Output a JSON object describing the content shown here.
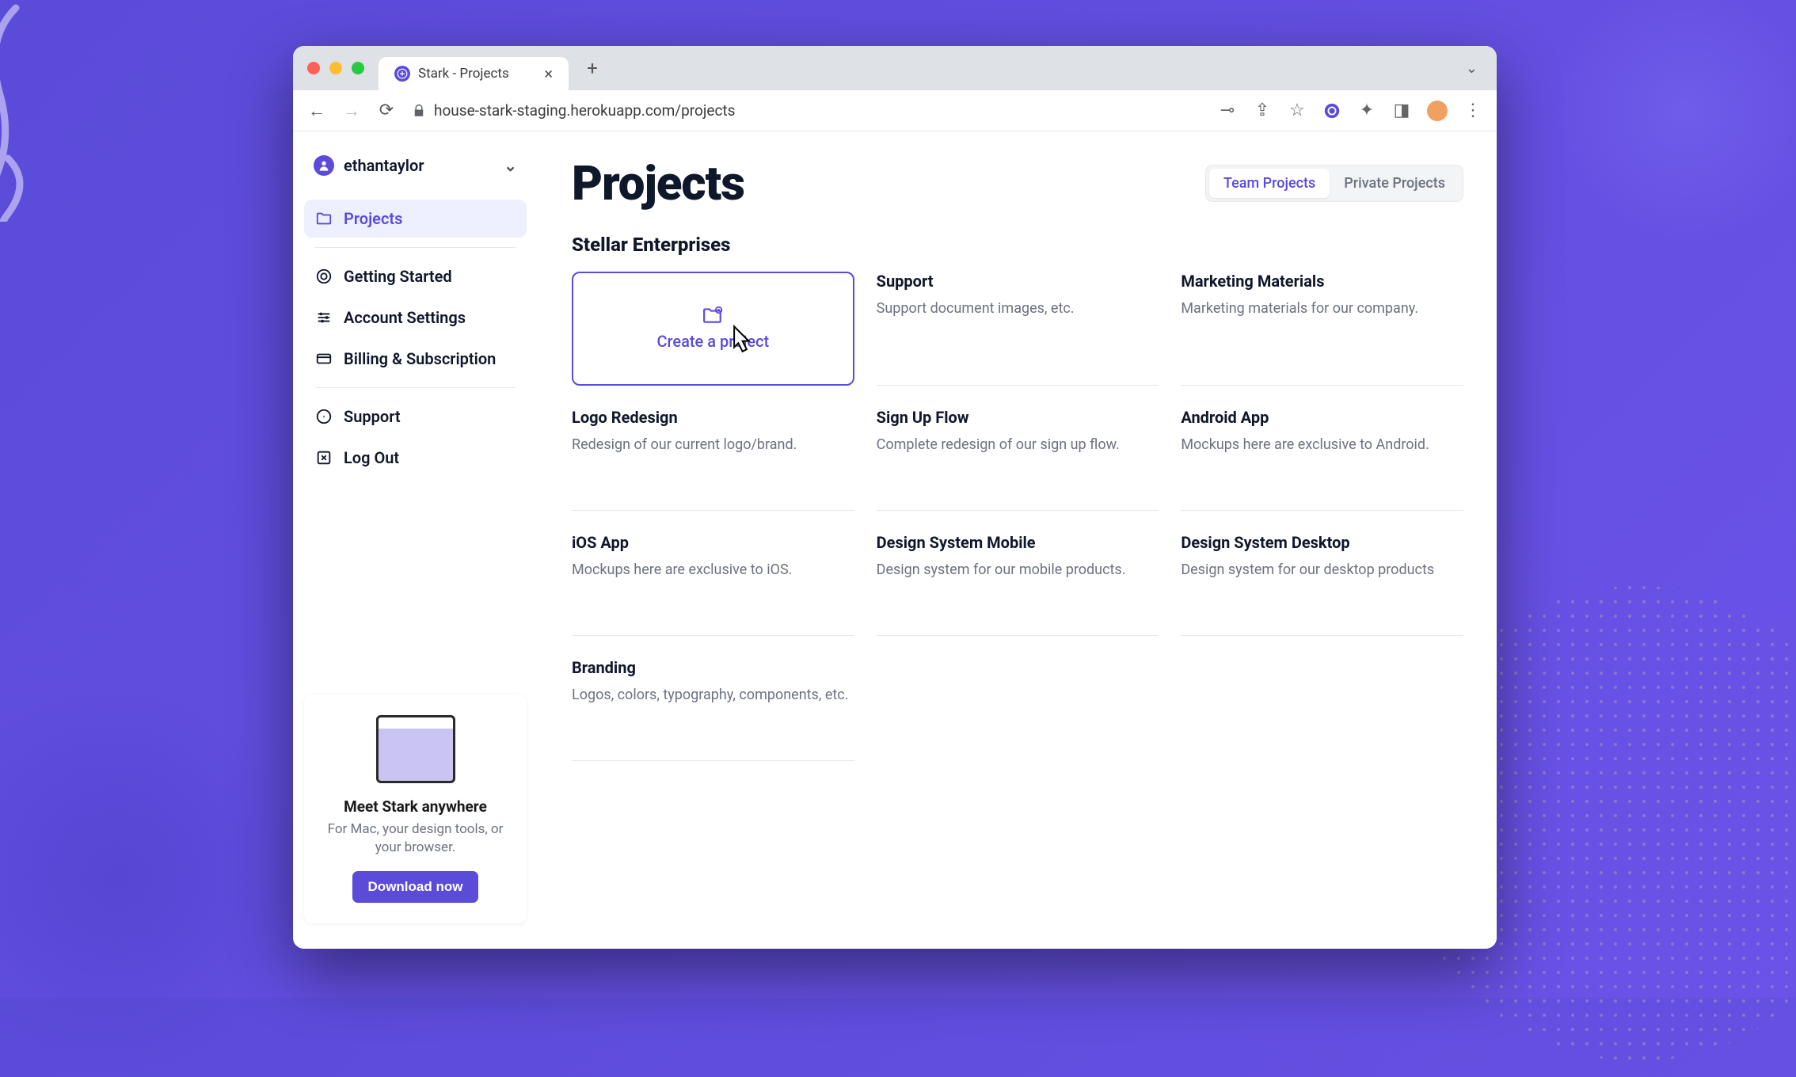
{
  "browser": {
    "tab_title": "Stark - Projects",
    "url": "house-stark-staging.herokuapp.com/projects"
  },
  "user": {
    "name": "ethantaylor"
  },
  "sidebar": {
    "items": [
      {
        "label": "Projects"
      },
      {
        "label": "Getting Started"
      },
      {
        "label": "Account Settings"
      },
      {
        "label": "Billing & Subscription"
      },
      {
        "label": "Support"
      },
      {
        "label": "Log Out"
      }
    ]
  },
  "promo": {
    "title": "Meet Stark anywhere",
    "text": "For Mac, your design tools, or your browser.",
    "cta": "Download now"
  },
  "page": {
    "title": "Projects",
    "tabs": {
      "team": "Team Projects",
      "private": "Private Projects"
    },
    "section": "Stellar Enterprises",
    "create_label": "Create a project",
    "projects": [
      {
        "title": "Support",
        "desc": "Support document images, etc."
      },
      {
        "title": "Marketing Materials",
        "desc": "Marketing materials for our company."
      },
      {
        "title": "Logo Redesign",
        "desc": "Redesign of our current logo/brand."
      },
      {
        "title": "Sign Up Flow",
        "desc": "Complete redesign of our sign up flow."
      },
      {
        "title": "Android App",
        "desc": "Mockups here are exclusive to Android."
      },
      {
        "title": "iOS App",
        "desc": "Mockups here are exclusive to iOS."
      },
      {
        "title": "Design System Mobile",
        "desc": "Design system for our mobile products."
      },
      {
        "title": "Design System Desktop",
        "desc": "Design system for our desktop products"
      },
      {
        "title": "Branding",
        "desc": "Logos, colors, typography, components, etc."
      }
    ]
  }
}
